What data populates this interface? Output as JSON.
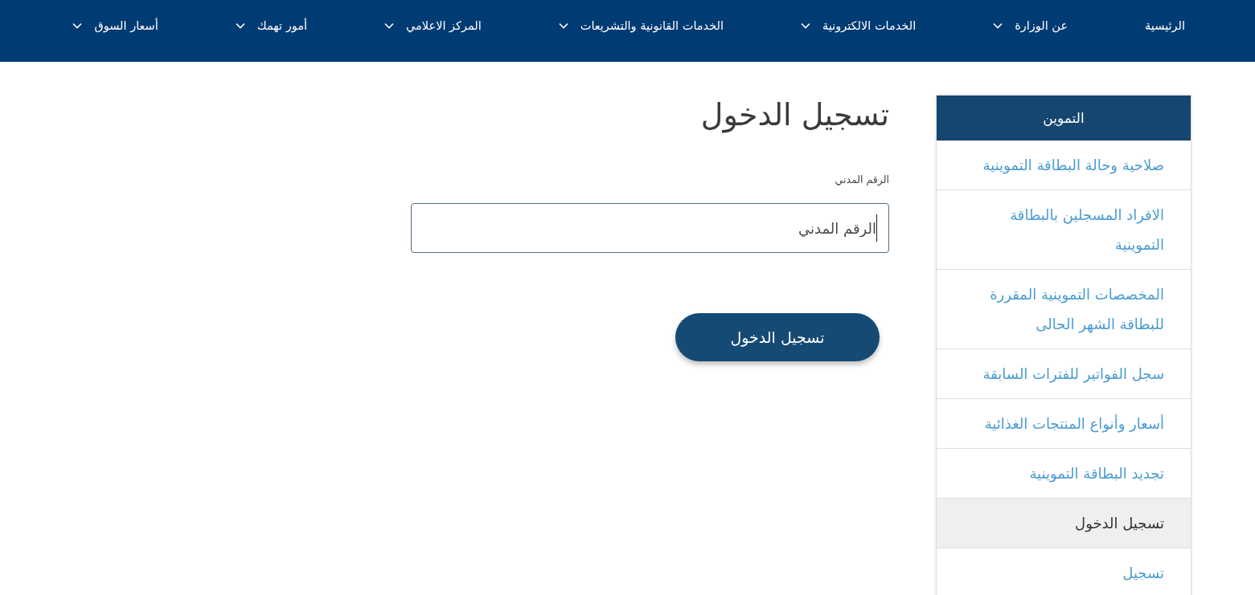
{
  "nav": {
    "items": [
      {
        "label": "الرئيسية",
        "has_menu": false
      },
      {
        "label": "عن الوزارة",
        "has_menu": true
      },
      {
        "label": "الخدمات الالكترونية",
        "has_menu": true
      },
      {
        "label": "الخدمات القانونية والتشريعات",
        "has_menu": true
      },
      {
        "label": "المركز الاعلامي",
        "has_menu": true
      },
      {
        "label": "أمور تهمك",
        "has_menu": true
      },
      {
        "label": "أسعار السوق",
        "has_menu": true
      }
    ]
  },
  "sidebar": {
    "title": "التموين",
    "items": [
      {
        "label": "صلاحية وحالة البطاقة التموينية",
        "selected": false
      },
      {
        "label": "الافراد المسجلين بالبطاقة التموينية",
        "selected": false
      },
      {
        "label": "المخصصات التموينية المقررة للبطاقة الشهر الحالى",
        "selected": false
      },
      {
        "label": "سجل الفواتير للفترات السابقة",
        "selected": false
      },
      {
        "label": "أسعار وأنواع المنتجات الغذائية",
        "selected": false
      },
      {
        "label": "تجديد البطاقة التموينية",
        "selected": false
      },
      {
        "label": "تسجيل الدخول",
        "selected": true
      },
      {
        "label": "تسجيل",
        "selected": false
      }
    ]
  },
  "login": {
    "title": "تسجيل الدخول",
    "field": {
      "label": "الرقم المدني",
      "placeholder": "الرقم المدني",
      "focused": true
    },
    "button": "تسجيل الدخول"
  }
}
